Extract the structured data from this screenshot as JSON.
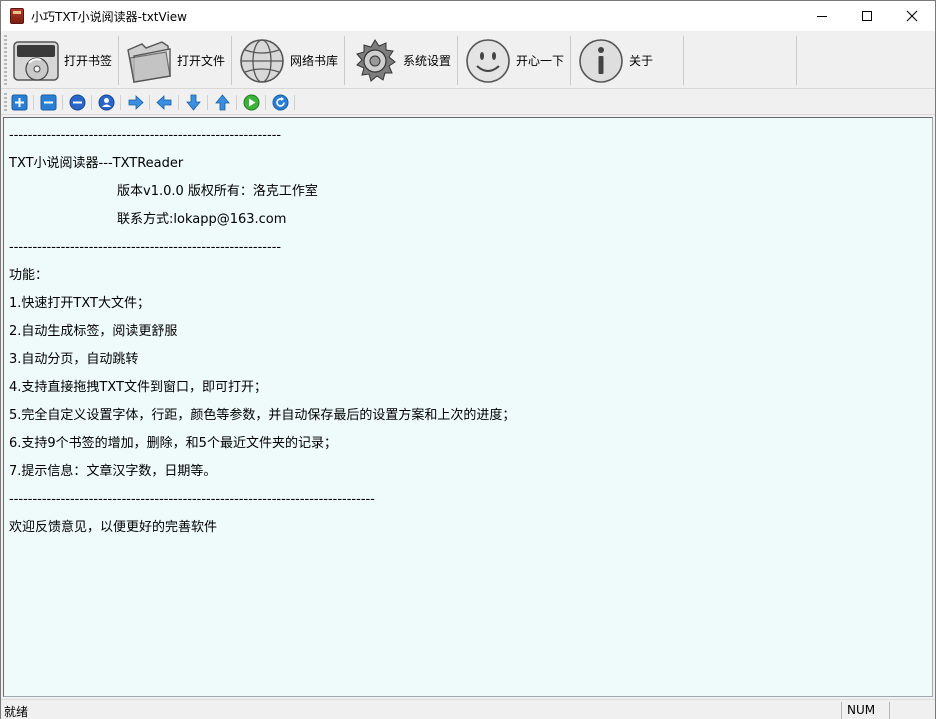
{
  "window": {
    "title": "小巧TXT小说阅读器-txtView",
    "icon": "book-icon"
  },
  "toolbar": {
    "items": [
      {
        "label": "打开书签",
        "icon": "disc-drive-icon"
      },
      {
        "label": "打开文件",
        "icon": "folder-icon"
      },
      {
        "label": "网络书库",
        "icon": "globe-icon"
      },
      {
        "label": "系统设置",
        "icon": "gear-icon"
      },
      {
        "label": "开心一下",
        "icon": "smiley-icon"
      },
      {
        "label": "关于",
        "icon": "info-icon"
      }
    ]
  },
  "small_toolbar": {
    "items": [
      {
        "icon": "zoom-in-plus-icon"
      },
      {
        "icon": "zoom-out-minus-icon"
      },
      {
        "icon": "circle-minus-icon"
      },
      {
        "icon": "user-circle-icon"
      },
      {
        "icon": "arrow-right-icon"
      },
      {
        "icon": "arrow-left-icon"
      },
      {
        "icon": "arrow-down-icon"
      },
      {
        "icon": "arrow-up-icon"
      },
      {
        "icon": "autoplay-icon"
      },
      {
        "icon": "refresh-icon"
      }
    ]
  },
  "content": {
    "lines": [
      {
        "text": "----------------------------------------------------------",
        "indent": false
      },
      {
        "text": "TXT小说阅读器---TXTReader",
        "indent": false
      },
      {
        "text": "版本v1.0.0 版权所有：洛克工作室",
        "indent": true
      },
      {
        "text": "联系方式:lokapp@163.com",
        "indent": true
      },
      {
        "text": "----------------------------------------------------------",
        "indent": false
      },
      {
        "text": "功能：",
        "indent": false
      },
      {
        "text": "1.快速打开TXT大文件；",
        "indent": false
      },
      {
        "text": "2.自动生成标签，阅读更舒服",
        "indent": false
      },
      {
        "text": "3.自动分页，自动跳转",
        "indent": false
      },
      {
        "text": "4.支持直接拖拽TXT文件到窗口，即可打开；",
        "indent": false
      },
      {
        "text": "5.完全自定义设置字体，行距，颜色等参数，并自动保存最后的设置方案和上次的进度；",
        "indent": false
      },
      {
        "text": "6.支持9个书签的增加，删除，和5个最近文件夹的记录；",
        "indent": false
      },
      {
        "text": "7.提示信息：文章汉字数，日期等。",
        "indent": false
      },
      {
        "text": "------------------------------------------------------------------------------",
        "indent": false
      },
      {
        "text": "欢迎反馈意见，以便更好的完善软件",
        "indent": false
      }
    ]
  },
  "status": {
    "text": "就绪",
    "num": "NUM"
  },
  "colors": {
    "content_bg": "#effafa",
    "chrome_bg": "#f0f0f0",
    "icon_blue": "#2a7fd4"
  }
}
